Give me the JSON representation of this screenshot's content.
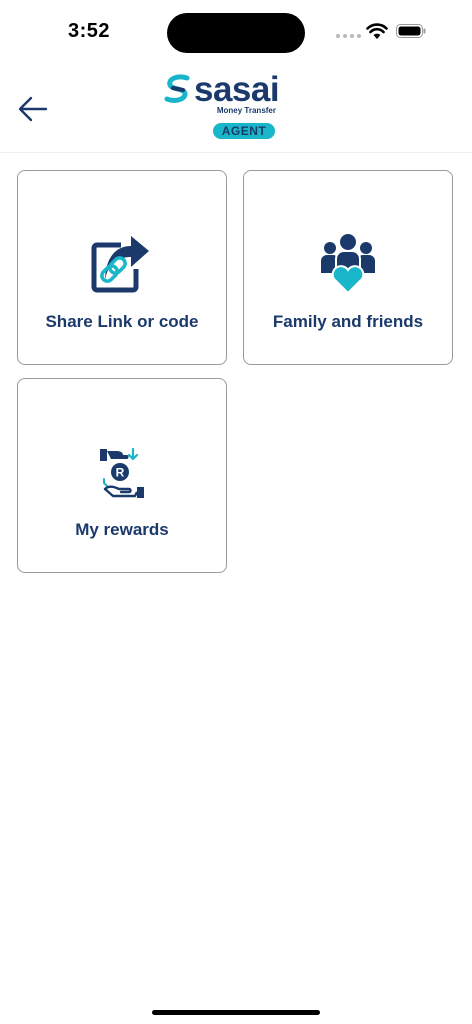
{
  "status_bar": {
    "time": "3:52"
  },
  "header": {
    "brand_name": "sasai",
    "brand_subtitle": "Money Transfer",
    "badge": "AGENT"
  },
  "tiles": [
    {
      "label": "Share Link or code",
      "icon": "share-link-icon"
    },
    {
      "label": "Family and friends",
      "icon": "family-heart-icon"
    },
    {
      "label": "My rewards",
      "icon": "rewards-icon"
    }
  ],
  "colors": {
    "primary": "#1b3a6b",
    "accent": "#19b6c9",
    "border": "#9a9a9a"
  }
}
